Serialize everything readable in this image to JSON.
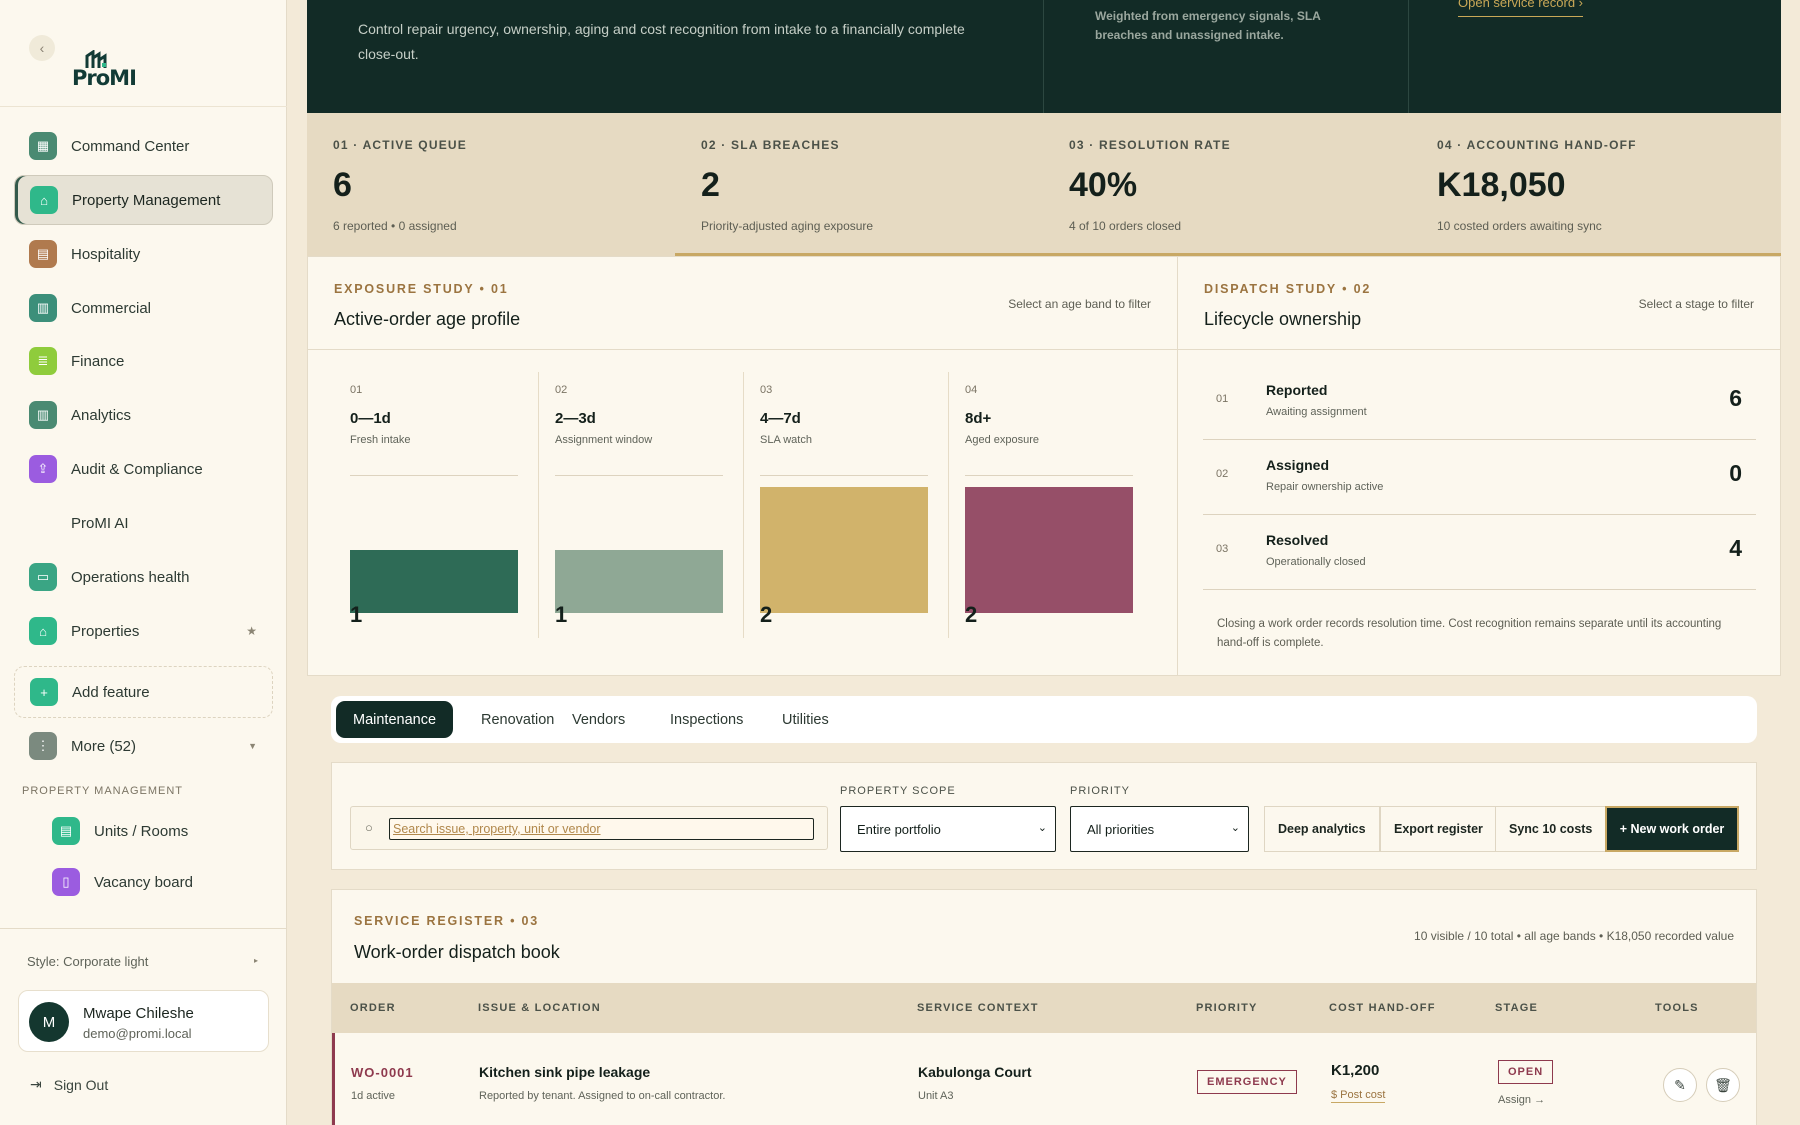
{
  "brand": {
    "logo_text": "ProMI"
  },
  "sidebar": {
    "items": [
      {
        "label": "Command Center",
        "color": "#4a8a72",
        "icon": "grid-icon",
        "glyph": "▦"
      },
      {
        "label": "Property Management",
        "color": "#2fb88a",
        "icon": "home-icon",
        "glyph": "⌂",
        "active": true
      },
      {
        "label": "Hospitality",
        "color": "#b07a4e",
        "icon": "calendar-icon",
        "glyph": "▤"
      },
      {
        "label": "Commercial",
        "color": "#3c8f7a",
        "icon": "document-icon",
        "glyph": "▥"
      },
      {
        "label": "Finance",
        "color": "#8fcc3c",
        "icon": "ledger-icon",
        "glyph": "≣"
      },
      {
        "label": "Analytics",
        "color": "#4a8a72",
        "icon": "report-icon",
        "glyph": "▥"
      },
      {
        "label": "Audit & Compliance",
        "color": "#9b5ce0",
        "icon": "upload-document-icon",
        "glyph": "⇪"
      },
      {
        "label": "ProMI AI"
      },
      {
        "label": "Operations health",
        "color": "#3aa584",
        "icon": "monitor-icon",
        "glyph": "▭"
      },
      {
        "label": "Properties",
        "color": "#2fb88a",
        "icon": "home-icon",
        "glyph": "⌂",
        "star": "★"
      }
    ],
    "add_feature": "Add feature",
    "more": "More (52)",
    "section_label": "PROPERTY MANAGEMENT",
    "sub_items": [
      {
        "label": "Units / Rooms",
        "color": "#2fb88a",
        "icon": "building-icon",
        "glyph": "▤"
      },
      {
        "label": "Vacancy board",
        "color": "#9b5ce0",
        "icon": "door-icon",
        "glyph": "▯"
      }
    ],
    "style_label": "Style: Corporate light",
    "user": {
      "initial": "M",
      "name": "Mwape Chileshe",
      "email": "demo@promi.local"
    },
    "signout": "Sign Out"
  },
  "hero": {
    "description": "Control repair urgency, ownership, aging and cost recognition from intake to a financially complete close-out.",
    "note": "Weighted from emergency signals, SLA breaches and unassigned intake.",
    "link": "Open service record ›"
  },
  "kpis": [
    {
      "label": "01 · ACTIVE QUEUE",
      "value": "6",
      "sub": "6 reported • 0 assigned"
    },
    {
      "label": "02 · SLA BREACHES",
      "value": "2",
      "sub": "Priority-adjusted aging exposure"
    },
    {
      "label": "03 · RESOLUTION RATE",
      "value": "40%",
      "sub": "4 of 10 orders closed"
    },
    {
      "label": "04 · ACCOUNTING HAND-OFF",
      "value": "K18,050",
      "sub": "10 costed orders awaiting sync"
    }
  ],
  "exposure": {
    "eyebrow": "EXPOSURE STUDY • 01",
    "title": "Active-order age profile",
    "hint": "Select an age band to filter",
    "max": 2,
    "bands": [
      {
        "index": "01",
        "range": "0—1d",
        "desc": "Fresh intake",
        "count": 1,
        "color": "#2e6b56"
      },
      {
        "index": "02",
        "range": "2—3d",
        "desc": "Assignment window",
        "count": 1,
        "color": "#8fa895"
      },
      {
        "index": "03",
        "range": "4—7d",
        "desc": "SLA watch",
        "count": 2,
        "color": "#d1b36b"
      },
      {
        "index": "04",
        "range": "8d+",
        "desc": "Aged exposure",
        "count": 2,
        "color": "#964f68"
      }
    ]
  },
  "dispatch": {
    "eyebrow": "DISPATCH STUDY • 02",
    "title": "Lifecycle ownership",
    "hint": "Select a stage to filter",
    "stages": [
      {
        "index": "01",
        "name": "Reported",
        "desc": "Awaiting assignment",
        "count": "6"
      },
      {
        "index": "02",
        "name": "Assigned",
        "desc": "Repair ownership active",
        "count": "0"
      },
      {
        "index": "03",
        "name": "Resolved",
        "desc": "Operationally closed",
        "count": "4"
      }
    ],
    "note": "Closing a work order records resolution time. Cost recognition remains separate until its accounting hand-off is complete."
  },
  "tabs": [
    "Maintenance",
    "Renovation",
    "Vendors",
    "Inspections",
    "Utilities"
  ],
  "filters": {
    "search_placeholder": "Search issue, property, unit or vendor",
    "scope_label": "PROPERTY SCOPE",
    "scope_value": "Entire portfolio",
    "priority_label": "PRIORITY",
    "priority_value": "All priorities",
    "deep_analytics": "Deep analytics",
    "export": "Export register",
    "sync": "Sync 10 costs",
    "new_order": "+  New work order"
  },
  "register": {
    "eyebrow": "SERVICE REGISTER • 03",
    "title": "Work-order dispatch book",
    "meta": "10 visible / 10 total • all age bands • K18,050 recorded value",
    "columns": [
      "ORDER",
      "ISSUE & LOCATION",
      "SERVICE CONTEXT",
      "PRIORITY",
      "COST HAND-OFF",
      "STAGE",
      "TOOLS"
    ],
    "rows": [
      {
        "order": "WO-0001",
        "age": "1d active",
        "issue": "Kitchen sink pipe leakage",
        "issue_desc": "Reported by tenant. Assigned to on-call contractor.",
        "property": "Kabulonga Court",
        "unit": "Unit A3",
        "priority": "EMERGENCY",
        "cost": "K1,200",
        "post_cost": "$  Post cost",
        "stage": "OPEN",
        "assign": "Assign →"
      }
    ]
  }
}
